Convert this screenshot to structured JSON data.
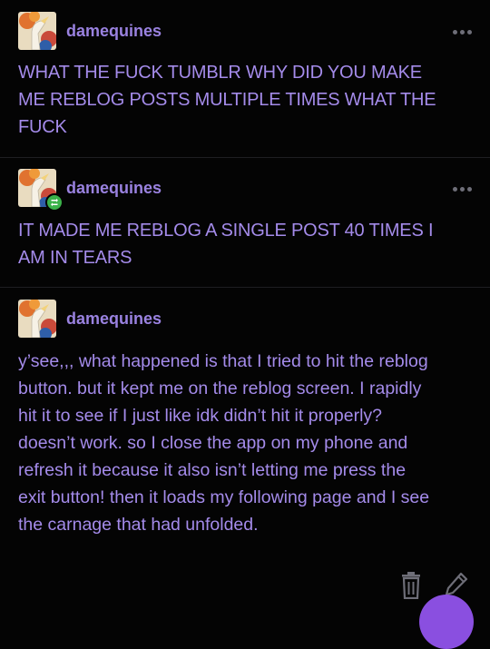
{
  "posts": [
    {
      "username": "damequines",
      "text": "WHAT THE FUCK TUMBLR WHY DID YOU MAKE\nME REBLOG POSTS MULTIPLE TIMES WHAT THE\nFUCK",
      "is_reblog": false
    },
    {
      "username": "damequines",
      "text": "IT MADE ME REBLOG A SINGLE POST 40 TIMES I\nAM IN TEARS",
      "is_reblog": true
    },
    {
      "username": "damequines",
      "text": "y’see,,, what happened is that I tried to hit the reblog\nbutton. but it kept me on the reblog screen. I rapidly\nhit it to see if I just like idk didn’t hit it properly?\ndoesn’t work. so I close the app on my phone and\nrefresh it because it also isn’t letting me press the\nexit button! then it loads my following page and I see\nthe carnage that had unfolded.",
      "is_reblog": false
    }
  ],
  "icons": {
    "more": "more-horizontal-icon",
    "delete": "trash-icon",
    "edit": "pencil-icon",
    "reblog_badge": "reblog-badge-icon",
    "fab": "compose-fab"
  },
  "colors": {
    "background": "#040404",
    "text": "#a48bea",
    "username": "#9a82e0",
    "icon": "#6e6e78",
    "reblog_badge": "#3bb24a",
    "fab": "#8a4fe0"
  }
}
